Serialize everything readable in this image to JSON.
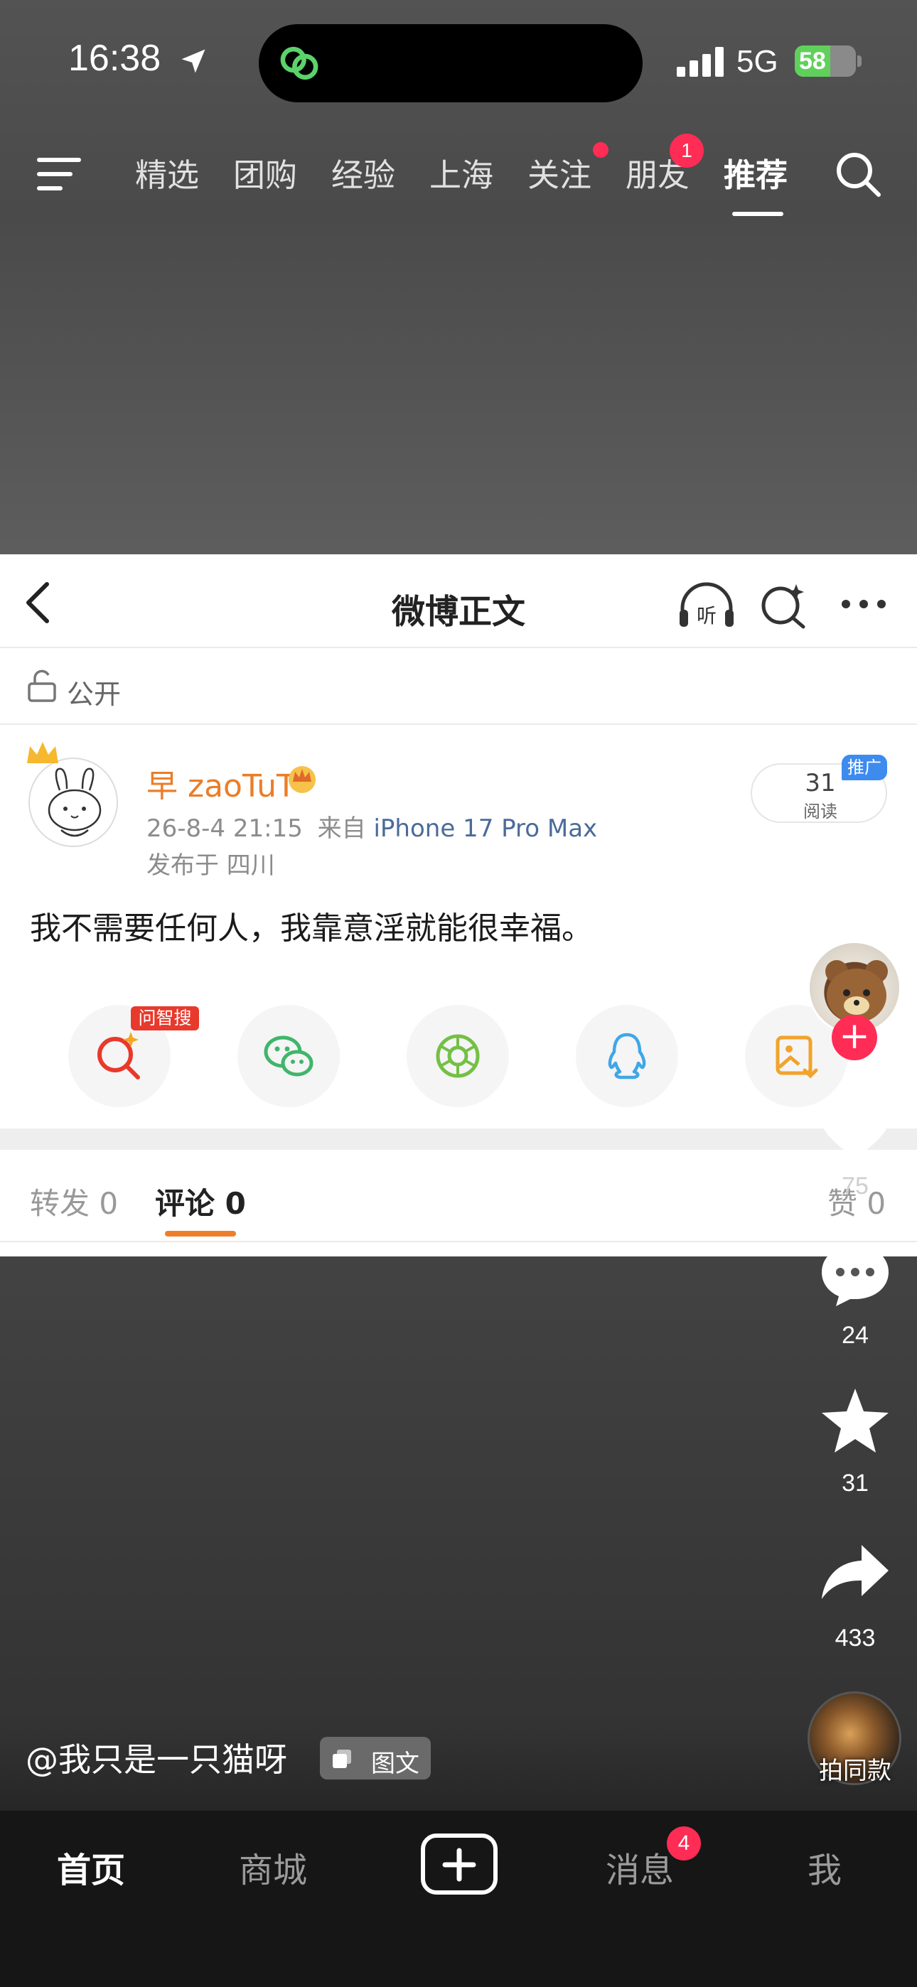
{
  "status_bar": {
    "time": "16:38",
    "network": "5G",
    "battery": "58",
    "battery_level": 0.58
  },
  "top_tabs": [
    {
      "label": "精选"
    },
    {
      "label": "团购"
    },
    {
      "label": "经验"
    },
    {
      "label": "上海"
    },
    {
      "label": "关注"
    },
    {
      "label": "朋友"
    },
    {
      "label": "推荐",
      "active": true
    }
  ],
  "friends_badge": "1",
  "weibo": {
    "nav_title": "微博正文",
    "visibility": "公开",
    "username": "早 zaoTuT",
    "datetime": "26-8-4 21:15",
    "from_label": "来自",
    "device": "iPhone 17 Pro Max",
    "location": "发布于 四川",
    "read_count": "31",
    "read_label": "阅读",
    "promo_tag": "推广",
    "post_text": "我不需要任何人，我靠意淫就能很幸福。",
    "zhisou_label": "问智搜",
    "share_icons": [
      "zhisou-search-icon",
      "wechat-icon",
      "moments-icon",
      "qq-icon",
      "save-image-icon"
    ],
    "tabs": {
      "repost": "转发 0",
      "comment": "评论 0",
      "like": "赞 0"
    }
  },
  "rail": {
    "likes": "75",
    "comments": "24",
    "favorites": "31",
    "shares": "433",
    "same_style_label": "拍同款"
  },
  "caption": {
    "author": "@我只是一只猫呀",
    "type_label": "图文"
  },
  "bottom_nav": {
    "home": "首页",
    "mall": "商城",
    "messages": "消息",
    "me": "我",
    "messages_badge": "4"
  },
  "colors": {
    "accent_orange": "#ef7e2a",
    "badge_red": "#ff2c55",
    "device_blue": "#4b6b9a",
    "promo_blue": "#3d8bef"
  }
}
